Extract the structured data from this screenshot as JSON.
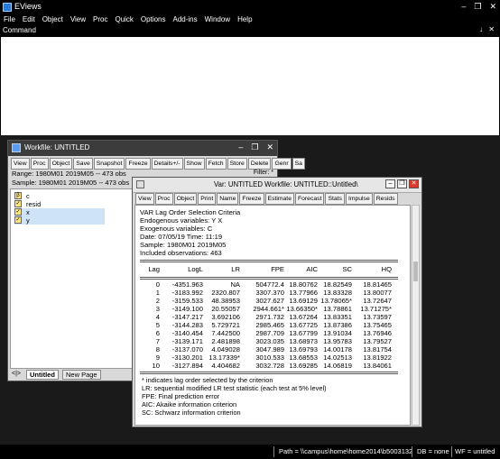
{
  "app": {
    "title": "EViews",
    "window_controls": [
      "–",
      "❐",
      "✕"
    ],
    "menu": [
      "File",
      "Edit",
      "Object",
      "View",
      "Proc",
      "Quick",
      "Options",
      "Add-ins",
      "Window",
      "Help"
    ],
    "command_label": "Command",
    "command_controls": "↓ ✕"
  },
  "workfile": {
    "title": "Workfile: UNTITLED",
    "controls": [
      "–",
      "❐",
      "✕"
    ],
    "toolbar": [
      "View",
      "Proc",
      "Object",
      "Save",
      "Snapshot",
      "Freeze",
      "Details+/-",
      "Show",
      "Fetch",
      "Store",
      "Delete",
      "Genr",
      "Sa"
    ],
    "range": "Range:  1980M01 2019M05  --  473 obs",
    "sample": "Sample: 1980M01 2019M05  --  473 obs",
    "filter": "Filter: *",
    "objects": [
      {
        "name": "c",
        "icon": "β"
      },
      {
        "name": "resid",
        "icon": "✓"
      },
      {
        "name": "x",
        "icon": "✓"
      },
      {
        "name": "y",
        "icon": "✓"
      }
    ],
    "tab_nav": "<|>",
    "tabs": [
      "Untitled",
      "New Page"
    ]
  },
  "var_window": {
    "title": "Var: UNTITLED   Workfile: UNTITLED::Untitled\\",
    "toolbar": [
      "View",
      "Proc",
      "Object",
      "Print",
      "Name",
      "Freeze",
      "Estimate",
      "Forecast",
      "Stats",
      "Impulse",
      "Resids"
    ],
    "header_lines": [
      "VAR Lag Order Selection Criteria",
      "Endogenous variables: Y X",
      "Exogenous variables: C",
      "Date: 07/05/19   Time: 11:19",
      "Sample: 1980M01 2019M05",
      "Included observations: 463"
    ],
    "columns": [
      "Lag",
      "LogL",
      "LR",
      "FPE",
      "AIC",
      "SC",
      "HQ"
    ],
    "rows": [
      [
        "0",
        "-4351.963",
        "NA",
        "504772.4",
        "18.80762",
        "18.82549",
        "18.81465"
      ],
      [
        "1",
        "-3183.992",
        "2320.807",
        "3307.370",
        "13.77966",
        "13.83328",
        "13.80077"
      ],
      [
        "2",
        "-3159.533",
        "48.38953",
        "3027.627",
        "13.69129",
        "13.78065*",
        "13.72647"
      ],
      [
        "3",
        "-3149.100",
        "20.55057",
        "2944.661*",
        "13.66350*",
        "13.78861",
        "13.71275*"
      ],
      [
        "4",
        "-3147.217",
        "3.692106",
        "2971.732",
        "13.67264",
        "13.83351",
        "13.73597"
      ],
      [
        "5",
        "-3144.283",
        "5.729721",
        "2985.465",
        "13.67725",
        "13.87386",
        "13.75465"
      ],
      [
        "6",
        "-3140.454",
        "7.442500",
        "2987.709",
        "13.67799",
        "13.91034",
        "13.76946"
      ],
      [
        "7",
        "-3139.171",
        "2.481898",
        "3023.035",
        "13.68973",
        "13.95783",
        "13.79527"
      ],
      [
        "8",
        "-3137.070",
        "4.049028",
        "3047.989",
        "13.69793",
        "14.00178",
        "13.81754"
      ],
      [
        "9",
        "-3130.201",
        "13.17339*",
        "3010.533",
        "13.68553",
        "14.02513",
        "13.81922"
      ],
      [
        "10",
        "-3127.894",
        "4.404682",
        "3032.728",
        "13.69285",
        "14.06819",
        "13.84061"
      ]
    ],
    "footnotes": [
      " * indicates lag order selected by the criterion",
      " LR: sequential modified LR test statistic (each test at 5% level)",
      " FPE: Final prediction error",
      " AIC: Akaike information criterion",
      " SC: Schwarz information criterion"
    ]
  },
  "status": {
    "path": "Path = \\\\campus\\home\\home2014\\b5003132",
    "db": "DB = none",
    "wf": "WF = untitled"
  }
}
